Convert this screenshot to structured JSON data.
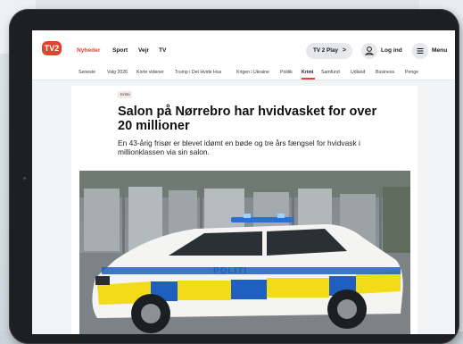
{
  "nav": {
    "logo": "TV2",
    "items": [
      "Nyheder",
      "Sport",
      "Vejr",
      "TV"
    ],
    "tv2play": "TV 2 Play",
    "tv2play_chevron": ">",
    "login": "Log ind",
    "menu": "Menu"
  },
  "subnav": {
    "items": [
      "Seneste",
      "Valg 2026",
      "Korte videoer",
      "Trump i Det Hvide Hus",
      "Krigen i Ukraine",
      "Politik",
      "Krimi",
      "Samfund",
      "Udland",
      "Business",
      "Penge"
    ]
  },
  "article": {
    "tag": "Krimi",
    "headline": "Salon på Nørrebro har hvidvasket for over 20 millioner",
    "lede": "En 43-årig frisør er blevet idømt en bøde og tre års fængsel for hvidvask i millionklassen via sin salon.",
    "photo_text": "POLITI"
  },
  "colors": {
    "accent": "#e6402f",
    "police_yellow": "#f2dc1a",
    "police_blue": "#1f5fbf"
  }
}
